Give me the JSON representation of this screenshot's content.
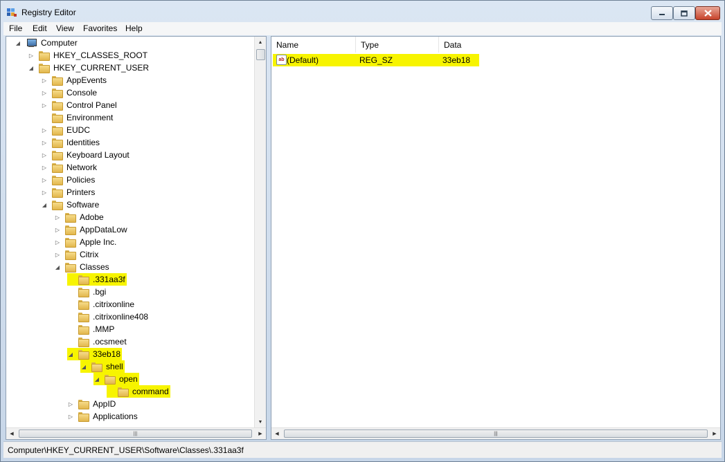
{
  "window": {
    "title": "Registry Editor"
  },
  "menu": [
    "File",
    "Edit",
    "View",
    "Favorites",
    "Help"
  ],
  "tree": {
    "nodes": [
      {
        "label": "Computer",
        "expander": "expanded",
        "icon": "computer-icon"
      },
      {
        "label": "HKEY_CLASSES_ROOT",
        "expander": "collapsed"
      },
      {
        "label": "HKEY_CURRENT_USER",
        "expander": "expanded"
      },
      {
        "label": "AppEvents",
        "expander": "collapsed"
      },
      {
        "label": "Console",
        "expander": "collapsed"
      },
      {
        "label": "Control Panel",
        "expander": "collapsed"
      },
      {
        "label": "Environment",
        "expander": "none"
      },
      {
        "label": "EUDC",
        "expander": "collapsed"
      },
      {
        "label": "Identities",
        "expander": "collapsed"
      },
      {
        "label": "Keyboard Layout",
        "expander": "collapsed"
      },
      {
        "label": "Network",
        "expander": "collapsed"
      },
      {
        "label": "Policies",
        "expander": "collapsed"
      },
      {
        "label": "Printers",
        "expander": "collapsed"
      },
      {
        "label": "Software",
        "expander": "expanded"
      },
      {
        "label": "Adobe",
        "expander": "collapsed"
      },
      {
        "label": "AppDataLow",
        "expander": "collapsed"
      },
      {
        "label": "Apple Inc.",
        "expander": "collapsed"
      },
      {
        "label": "Citrix",
        "expander": "collapsed"
      },
      {
        "label": "Classes",
        "expander": "expanded"
      },
      {
        "label": ".331aa3f",
        "expander": "none",
        "highlighted": true
      },
      {
        "label": ".bgi",
        "expander": "none"
      },
      {
        "label": ".citrixonline",
        "expander": "none"
      },
      {
        "label": ".citrixonline408",
        "expander": "none"
      },
      {
        "label": ".MMP",
        "expander": "none"
      },
      {
        "label": ".ocsmeet",
        "expander": "none"
      },
      {
        "label": "33eb18",
        "expander": "expanded",
        "highlighted": true
      },
      {
        "label": "shell",
        "expander": "expanded",
        "highlighted": true
      },
      {
        "label": "open",
        "expander": "expanded",
        "highlighted": true
      },
      {
        "label": "command",
        "expander": "none",
        "highlighted": true
      },
      {
        "label": "AppID",
        "expander": "collapsed"
      },
      {
        "label": "Applications",
        "expander": "collapsed"
      }
    ]
  },
  "values": {
    "columns": [
      "Name",
      "Type",
      "Data"
    ],
    "rows": [
      {
        "name": "(Default)",
        "type": "REG_SZ",
        "data": "33eb18",
        "highlighted": true
      }
    ]
  },
  "status": {
    "path": "Computer\\HKEY_CURRENT_USER\\Software\\Classes\\.331aa3f"
  },
  "colors": {
    "highlight": "#f7f400",
    "window_frame": "#c9d8ea"
  }
}
